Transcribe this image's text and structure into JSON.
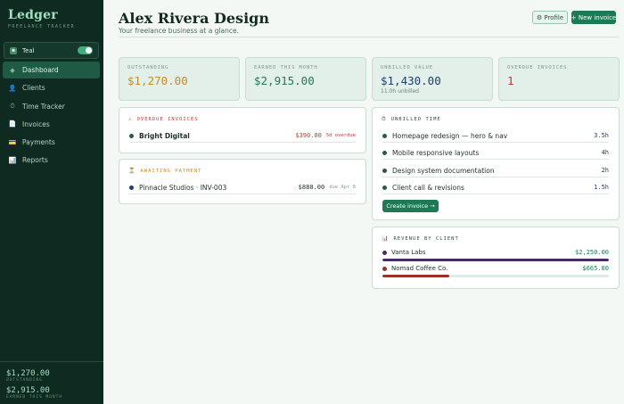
{
  "brand": {
    "title": "Ledger",
    "subtitle": "FREELANCE TRACKER"
  },
  "theme": {
    "icon": "palette-icon",
    "label": "Teal",
    "enabled": true
  },
  "nav": [
    {
      "icon": "◆",
      "icon_name": "dashboard-icon",
      "label": "Dashboard",
      "active": true
    },
    {
      "icon": "👤",
      "icon_name": "clients-icon",
      "label": "Clients",
      "active": false
    },
    {
      "icon": "⏱",
      "icon_name": "timer-icon",
      "label": "Time Tracker",
      "active": false
    },
    {
      "icon": "📄",
      "icon_name": "invoice-icon",
      "label": "Invoices",
      "active": false
    },
    {
      "icon": "💳",
      "icon_name": "payments-icon",
      "label": "Payments",
      "active": false
    },
    {
      "icon": "📊",
      "icon_name": "reports-icon",
      "label": "Reports",
      "active": false
    }
  ],
  "sidebar_footer": [
    {
      "amount": "$1,270.00",
      "label": "OUTSTANDING"
    },
    {
      "amount": "$2,915.00",
      "label": "EARNED THIS MONTH"
    }
  ],
  "header": {
    "title": "Alex Rivera Design",
    "subtitle": "Your freelance business at a glance.",
    "profile_button": "⚙ Profile",
    "new_invoice_button": "+ New invoice"
  },
  "stats": [
    {
      "label": "OUTSTANDING",
      "value": "$1,270.00",
      "color": "#c8892b",
      "note": ""
    },
    {
      "label": "EARNED THIS MONTH",
      "value": "$2,915.00",
      "color": "#1e7a55",
      "note": ""
    },
    {
      "label": "UNBILLED VALUE",
      "value": "$1,430.00",
      "color": "#1d3f6e",
      "note": "11.0h unbilled"
    },
    {
      "label": "OVERDUE INVOICES",
      "value": "1",
      "color": "#c0392b",
      "note": ""
    }
  ],
  "overdue": {
    "title": "OVERDUE INVOICES",
    "icon": "⚠",
    "color": "#c0392b",
    "items": [
      {
        "name": "Bright Digital",
        "amount": "$390.00",
        "meta": "5d overdue"
      }
    ]
  },
  "awaiting": {
    "title": "AWAITING PAYMENT",
    "icon": "⏳",
    "color": "#c8892b",
    "items": [
      {
        "name": "Pinnacle Studios · INV-003",
        "amount": "$880.00",
        "meta": "due Apr 8"
      }
    ]
  },
  "unbilled": {
    "title": "UNBILLED TIME",
    "icon": "⏱",
    "items": [
      {
        "name": "Homepage redesign — hero & nav",
        "hours": "3.5h"
      },
      {
        "name": "Mobile responsive layouts",
        "hours": "4h"
      },
      {
        "name": "Design system documentation",
        "hours": "2h"
      },
      {
        "name": "Client call & revisions",
        "hours": "1.5h"
      }
    ],
    "create_button": "Create invoice →"
  },
  "revenue": {
    "title": "REVENUE BY CLIENT",
    "icon": "📊",
    "items": [
      {
        "name": "Vanta Labs",
        "amount": "$2,250.00",
        "share": 1.0,
        "color": "#4a2a66"
      },
      {
        "name": "Nomad Coffee Co.",
        "amount": "$665.00",
        "share": 0.296,
        "color": "#9a3324"
      }
    ]
  }
}
